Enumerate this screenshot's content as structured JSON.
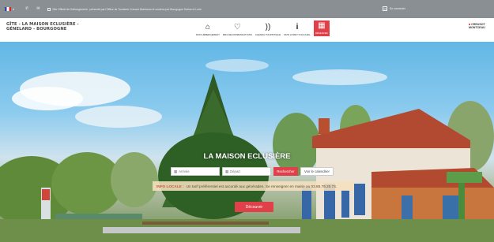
{
  "topbar": {
    "lang_icon": "france-flag-icon",
    "phone_icon": "phone-icon",
    "mail_icon": "mail-icon",
    "promo_text": "Site Officiel de l'hébergement - présenté par l'Office de Tourisme Creusot Montceau et soutenu par Bourgogne Saône et Loire",
    "account_label": "Se connecter"
  },
  "header": {
    "title": "GÎTE - LA MAISON ECLUSIÈRE - GÉNELARD - BOURGOGNE",
    "nav": [
      {
        "label": "MON HÉBERGEMENT",
        "icon": "home-icon"
      },
      {
        "label": "MES RECOMMANDATIONS",
        "icon": "heart-icon"
      },
      {
        "label": "AGENDA TOURISTIQUE",
        "icon": "rss-icon"
      },
      {
        "label": "MON LIVRET D'ACCUEIL",
        "icon": "info-icon"
      },
      {
        "label": "RÉSERVER",
        "icon": "calendar-icon"
      }
    ],
    "logo_text_1": "CREUSOT",
    "logo_text_2": "MONTCEAU"
  },
  "hero": {
    "title": "LA MAISON ECLUSIÈRE",
    "arrival_placeholder": "Arrivée",
    "departure_placeholder": "Départ",
    "search_label": "Rechercher",
    "calendar_label": "Voir le calendrier",
    "info_label": "INFO LOCALE :",
    "info_text": "Un tarif préférentiel est accordé aux générades. Se renseigner en mairie au 03.85.79.20.74.",
    "discover_label": "Découvrir"
  },
  "colors": {
    "accent": "#e0404a",
    "topbar": "#8a8f94"
  }
}
